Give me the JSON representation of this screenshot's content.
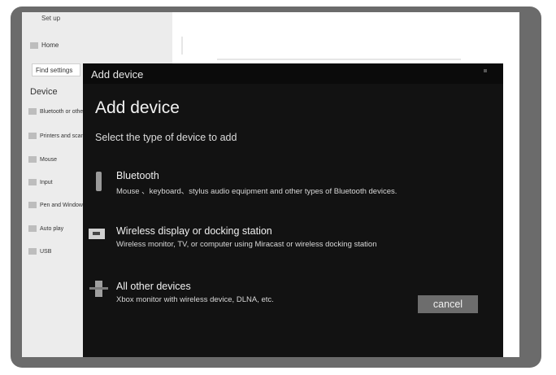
{
  "sidebar": {
    "setup": "Set up",
    "home": "Home",
    "find_settings": "Find settings",
    "heading": "Device",
    "items": [
      {
        "label": "Bluetooth or other d"
      },
      {
        "label": "Printers and scanne"
      },
      {
        "label": "Mouse"
      },
      {
        "label": "Input"
      },
      {
        "label": "Pen and Windows I"
      },
      {
        "label": "Auto play"
      },
      {
        "label": "USB"
      }
    ]
  },
  "dialog": {
    "window_title": "Add device",
    "heading": "Add device",
    "subheading": "Select the type of device to add",
    "options": [
      {
        "title": "Bluetooth",
        "description": "Mouse 、keyboard、stylus audio equipment and other types of Bluetooth devices.",
        "icon": "bluetooth-icon"
      },
      {
        "title": "Wireless display or docking station",
        "description": "Wireless monitor, TV, or computer using Miracast or wireless docking station",
        "icon": "display-icon"
      },
      {
        "title": "All other devices",
        "description": "Xbox monitor with wireless device, DLNA, etc.",
        "icon": "plus-icon"
      }
    ],
    "cancel_label": "cancel"
  }
}
